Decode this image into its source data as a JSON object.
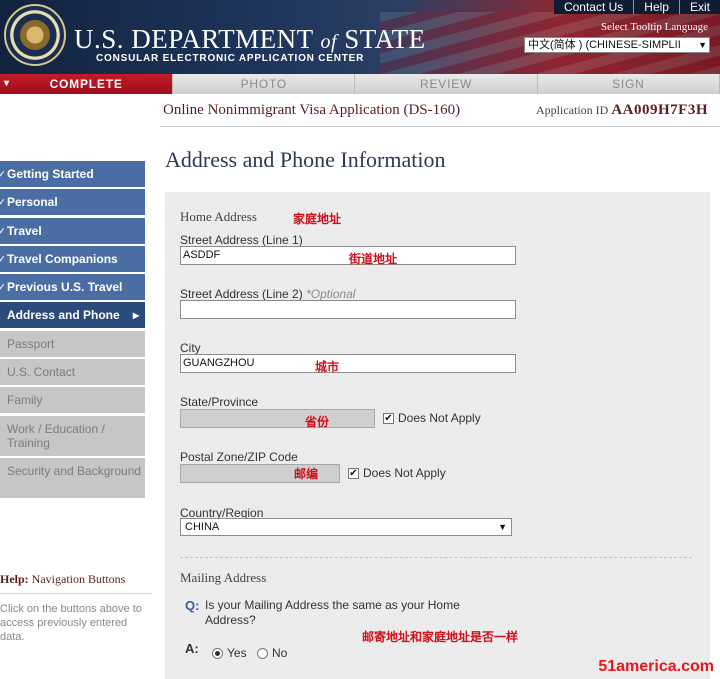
{
  "header": {
    "title_prefix": "U.S. DEPARTMENT ",
    "title_of": "of",
    "title_suffix": " STATE",
    "subtitle": "CONSULAR ELECTRONIC APPLICATION CENTER",
    "links": [
      "Contact Us",
      "Help",
      "Exit"
    ],
    "language_label": "Select Tooltip Language",
    "language_value": "中文(简体 ) (CHINESE-SIMPLII"
  },
  "progress": [
    "COMPLETE",
    "PHOTO",
    "REVIEW",
    "SIGN"
  ],
  "app": {
    "form_name": "Online Nonimmigrant Visa Application (DS-160)",
    "id_label": "Application ID",
    "id_value": "AA009H7F3H"
  },
  "page_title": "Address and Phone Information",
  "sidebar": {
    "items": [
      {
        "label": "Getting Started",
        "state": "done"
      },
      {
        "label": "Personal",
        "state": "done"
      },
      {
        "label": "Travel",
        "state": "done"
      },
      {
        "label": "Travel Companions",
        "state": "done"
      },
      {
        "label": "Previous U.S. Travel",
        "state": "done"
      },
      {
        "label": "Address and Phone",
        "state": "current"
      },
      {
        "label": "Passport",
        "state": "todo"
      },
      {
        "label": "U.S. Contact",
        "state": "todo"
      },
      {
        "label": "Family",
        "state": "todo"
      },
      {
        "label": "Work / Education / Training",
        "state": "todo"
      },
      {
        "label": "Security and Background",
        "state": "todo"
      }
    ]
  },
  "help": {
    "title_prefix": "Help:",
    "title_rest": " Navigation Buttons",
    "text": "Click on the buttons above to access previously entered data."
  },
  "form": {
    "home_heading": "Home Address",
    "street1_label": "Street Address (Line 1)",
    "street1_value": "ASDDF",
    "street2_label": "Street Address (Line 2)",
    "street2_optional": "*Optional",
    "street2_value": "",
    "city_label": "City",
    "city_value": "GUANGZHOU",
    "state_label": "State/Province",
    "state_na": "Does Not Apply",
    "state_checked": true,
    "zip_label": "Postal Zone/ZIP Code",
    "zip_na": "Does Not Apply",
    "zip_checked": true,
    "country_label": "Country/Region",
    "country_value": "CHINA",
    "mailing_heading": "Mailing Address",
    "q_mark": "Q:",
    "question": "Is your Mailing Address the same as your Home Address?",
    "a_mark": "A:",
    "yes_label": "Yes",
    "no_label": "No",
    "answer": "Yes"
  },
  "annotations": {
    "home": "家庭地址",
    "street": "街道地址",
    "city": "城市",
    "state": "省份",
    "zip": "邮编",
    "mailing": "邮寄地址和家庭地址是否一样"
  },
  "watermark": "51america.com",
  "colors": {
    "header_blue": "#1f355c",
    "active_red": "#c41a28",
    "nav_done": "#4a6ea3",
    "nav_current": "#2a4b7c",
    "annotation_red": "#d0101a"
  }
}
